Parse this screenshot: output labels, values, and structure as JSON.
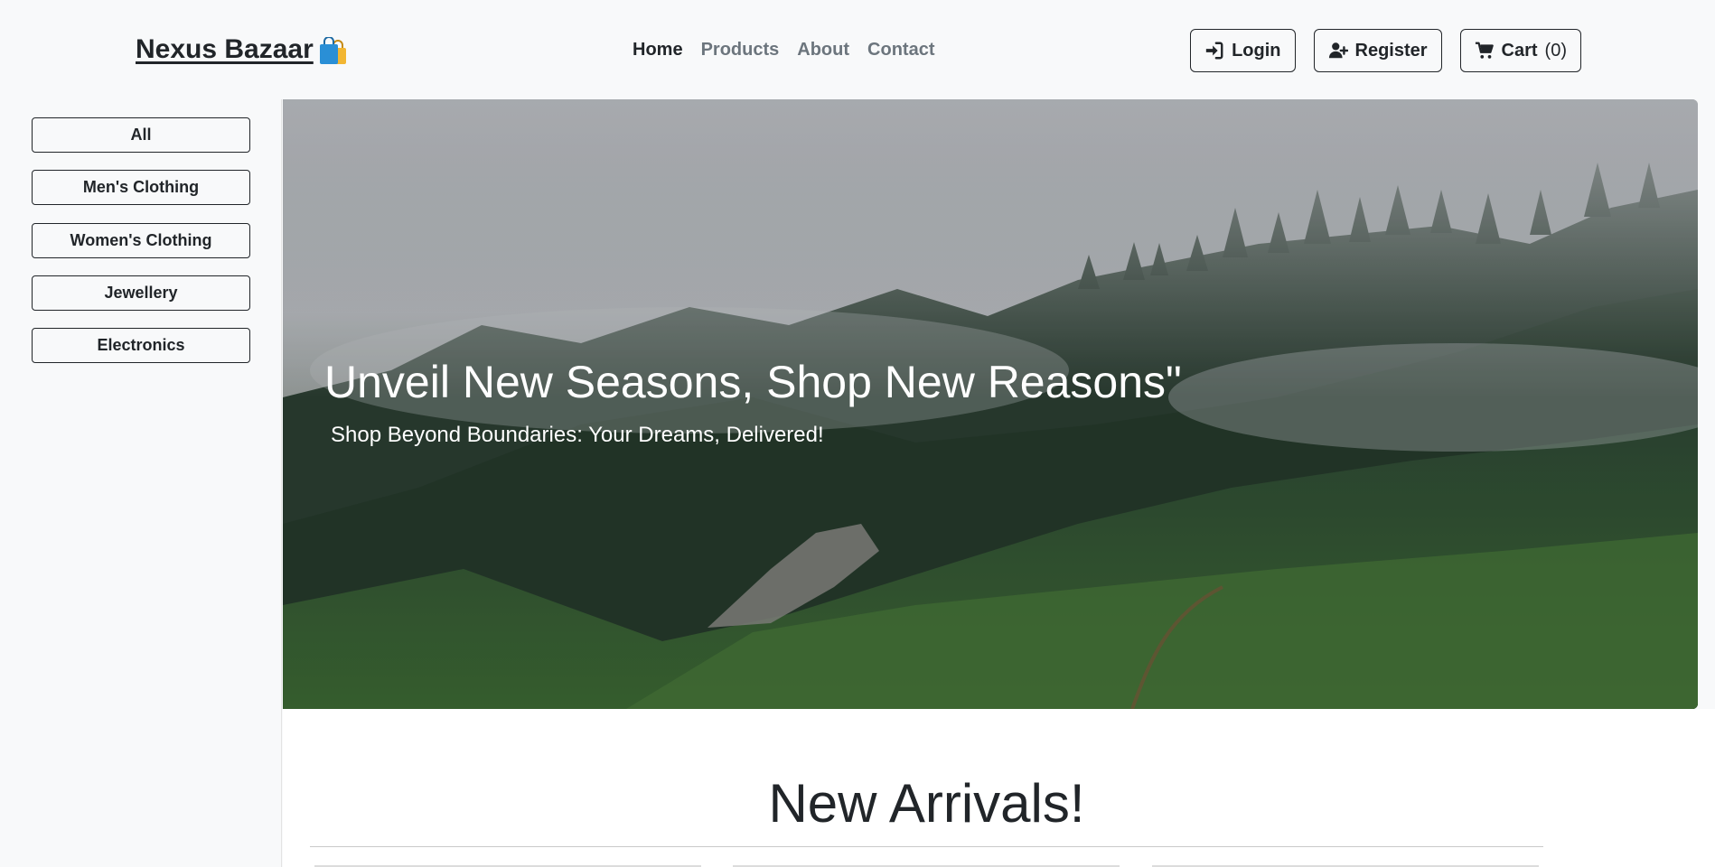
{
  "brand": {
    "name": "Nexus Bazaar",
    "icon": "shopping-bags-icon"
  },
  "nav": {
    "links": [
      {
        "label": "Home",
        "active": true
      },
      {
        "label": "Products",
        "active": false
      },
      {
        "label": "About",
        "active": false
      },
      {
        "label": "Contact",
        "active": false
      }
    ]
  },
  "actions": {
    "login": {
      "label": "Login",
      "icon": "sign-in-icon"
    },
    "register": {
      "label": "Register",
      "icon": "user-plus-icon"
    },
    "cart": {
      "label": "Cart",
      "count": "(0)",
      "icon": "cart-icon"
    }
  },
  "sidebar": {
    "categories": [
      "All",
      "Men's Clothing",
      "Women's Clothing",
      "Jewellery",
      "Electronics"
    ]
  },
  "hero": {
    "title": "Unveil New Seasons, Shop New Reasons\"",
    "subtitle": "Shop Beyond Boundaries: Your Dreams, Delivered!"
  },
  "section": {
    "title": "New Arrivals!"
  },
  "colors": {
    "background": "#f8f9fa",
    "text": "#212529",
    "muted_link": "#6c757d",
    "forest_dark": "#1f3a2a",
    "mist": "#b7bcc2"
  }
}
